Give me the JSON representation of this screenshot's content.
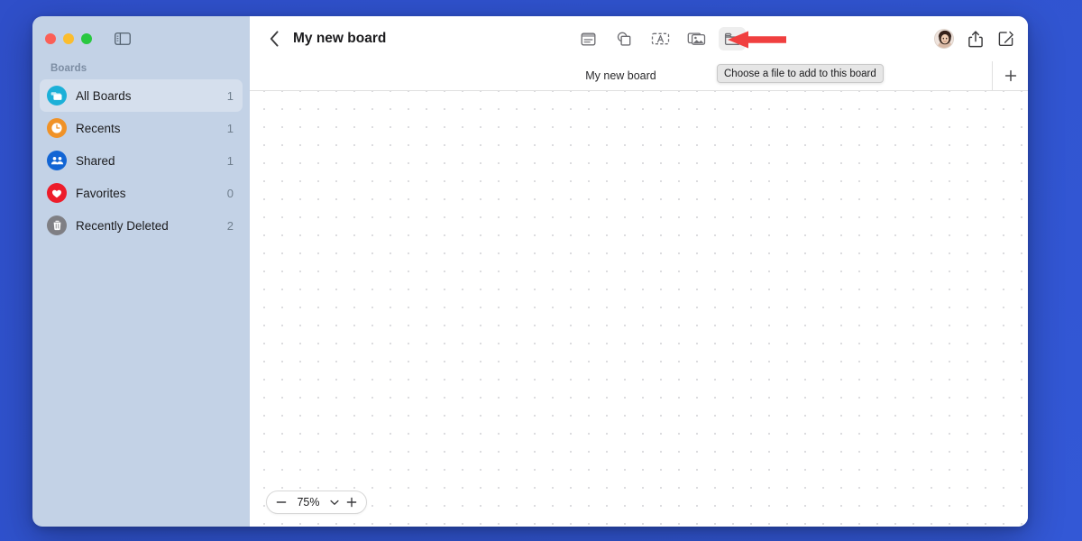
{
  "window": {
    "traffic_lights": [
      {
        "name": "close",
        "color": "#fb5f57"
      },
      {
        "name": "minimize",
        "color": "#fbbd2e"
      },
      {
        "name": "maximize",
        "color": "#29c840"
      }
    ],
    "sidebar_toggle_icon": "sidebar-toggle-icon",
    "desktop_background": "#2f52cd"
  },
  "sidebar": {
    "section_label": "Boards",
    "items": [
      {
        "label": "All Boards",
        "count": "1",
        "icon": "all-boards-icon",
        "color": "#1cb0d8",
        "selected": true
      },
      {
        "label": "Recents",
        "count": "1",
        "icon": "recents-clock-icon",
        "color": "#f09227",
        "selected": false
      },
      {
        "label": "Shared",
        "count": "1",
        "icon": "shared-people-icon",
        "color": "#1265d4",
        "selected": false
      },
      {
        "label": "Favorites",
        "count": "0",
        "icon": "favorites-heart-icon",
        "color": "#ed1c2a",
        "selected": false
      },
      {
        "label": "Recently Deleted",
        "count": "2",
        "icon": "trash-icon",
        "color": "#7f7f84",
        "selected": false
      }
    ]
  },
  "toolbar": {
    "back_icon": "chevron-left-icon",
    "title": "My new board",
    "tools": [
      {
        "name": "sticky-note-tool",
        "icon": "sticky-note-icon",
        "active": false
      },
      {
        "name": "shapes-tool",
        "icon": "shapes-icon",
        "active": false
      },
      {
        "name": "text-box-tool",
        "icon": "text-box-icon",
        "active": false
      },
      {
        "name": "media-tool",
        "icon": "media-photos-icon",
        "active": false
      },
      {
        "name": "file-tool",
        "icon": "folder-icon",
        "active": true
      }
    ],
    "avatar_name": "user-avatar",
    "share_icon": "share-icon",
    "compose_icon": "compose-icon"
  },
  "tabbar": {
    "active_tab": "My new board",
    "add_tab_icon": "plus-icon"
  },
  "tooltip": {
    "text": "Choose a file to add to this board",
    "background": "#e6e6e6"
  },
  "annotation": {
    "arrow_color": "#f03f3f",
    "points_to": "file-tool"
  },
  "canvas": {
    "grid": "dot-grid",
    "dot_color": "#dcdcdf",
    "dot_spacing_px": 20
  },
  "zoom_control": {
    "minus_icon": "minus-icon",
    "value": "75%",
    "chevron_icon": "chevron-down-icon",
    "plus_icon": "plus-icon"
  }
}
